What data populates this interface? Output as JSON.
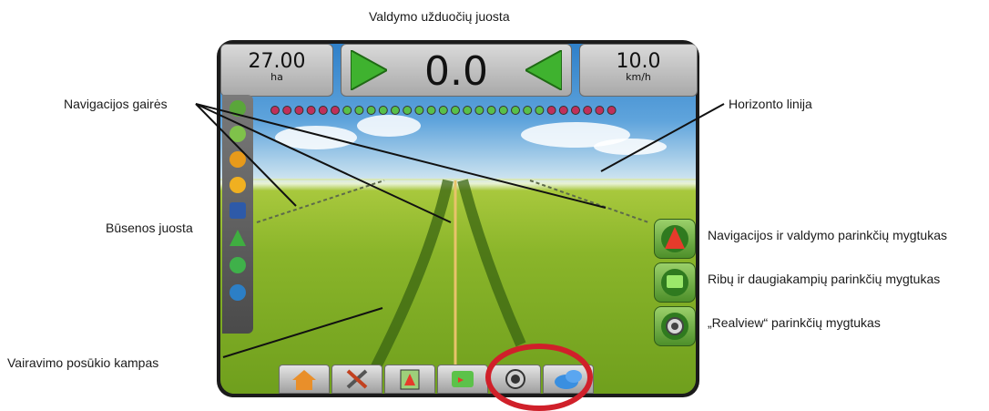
{
  "labels": {
    "taskbar": "Valdymo užduočių juosta",
    "guidelines": "Navigacijos gairės",
    "horizon": "Horizonto linija",
    "statusbar": "Būsenos juosta",
    "nav_options": "Navigacijos ir valdymo parinkčių mygtukas",
    "boundary_options": "Ribų ir daugiakampių parinkčių mygtukas",
    "realview_options": "„Realview“ parinkčių mygtukas",
    "steering_angle": "Vairavimo posūkio kampas"
  },
  "display": {
    "area_value": "27.00",
    "area_unit": "ha",
    "swath_value": "0.0",
    "speed_value": "10.0",
    "speed_unit": "km/h"
  },
  "status_icons": [
    "gps-icon",
    "guidance-icon",
    "warning-icon",
    "section-icon",
    "tilt-icon",
    "steering-icon",
    "rate-icon",
    "person-icon"
  ],
  "bottom_tabs": [
    "home-icon",
    "tools-icon",
    "guidance-tab-icon",
    "map-tab-icon",
    "camera-tab-icon",
    "cloud-tab-icon"
  ],
  "colors": {
    "accent_green": "#4d8f2a",
    "highlight_circle": "#d0202a"
  }
}
